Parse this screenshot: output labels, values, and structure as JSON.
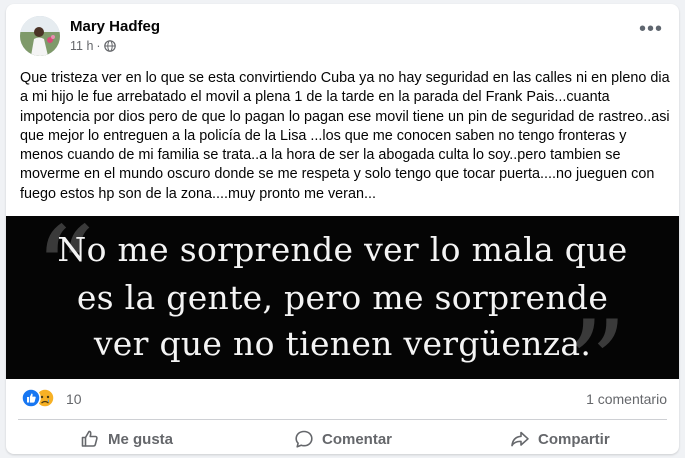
{
  "post": {
    "author": "Mary Hadfeg",
    "time": "11 h",
    "separator": "·",
    "privacy_icon": "globe-icon",
    "menu_icon": "more-options-icon",
    "menu_label": "•••",
    "text": "Que tristeza ver en lo que se esta convirtiendo Cuba ya no hay seguridad en las calles ni en pleno dia a mi hijo le fue arrebatado el movil a plena 1 de la tarde en la parada del Frank Pais...cuanta impotencia por dios pero de que lo pagan lo pagan ese movil tiene un pin de seguridad de rastreo..asi que mejor lo entreguen a la policía de la Lisa ...los que me conocen saben no tengo fronteras y menos cuando de mi familia se trata..a la hora de ser la abogada culta lo soy..pero tambien se moverme en el mundo oscuro donde se me respeta y solo tengo que tocar puerta....no jueguen con fuego estos hp son de la zona....muy pronto me veran..."
  },
  "image": {
    "lines": [
      "No me sorprende ver lo mala que",
      "es la gente, pero me sorprende",
      "ver que no tienen vergüenza."
    ],
    "open_quote": "“",
    "close_quote": "”",
    "colors": {
      "background": "#050505",
      "text": "#f4f4f4",
      "quote_marks": "#3a3a3a"
    }
  },
  "engagement": {
    "reaction_icons": [
      "like-reaction-icon",
      "sad-reaction-icon"
    ],
    "reaction_count": "10",
    "comment_count": "1 comentario"
  },
  "actions": [
    {
      "label": "Me gusta",
      "icon": "thumbs-up-icon"
    },
    {
      "label": "Comentar",
      "icon": "comment-icon"
    },
    {
      "label": "Compartir",
      "icon": "share-icon"
    }
  ],
  "colors": {
    "page_bg": "#f0f2f5",
    "card_bg": "#ffffff",
    "secondary_text": "#65676b",
    "like_blue": "#1877f2",
    "sad_yellow": "#f7b125"
  }
}
